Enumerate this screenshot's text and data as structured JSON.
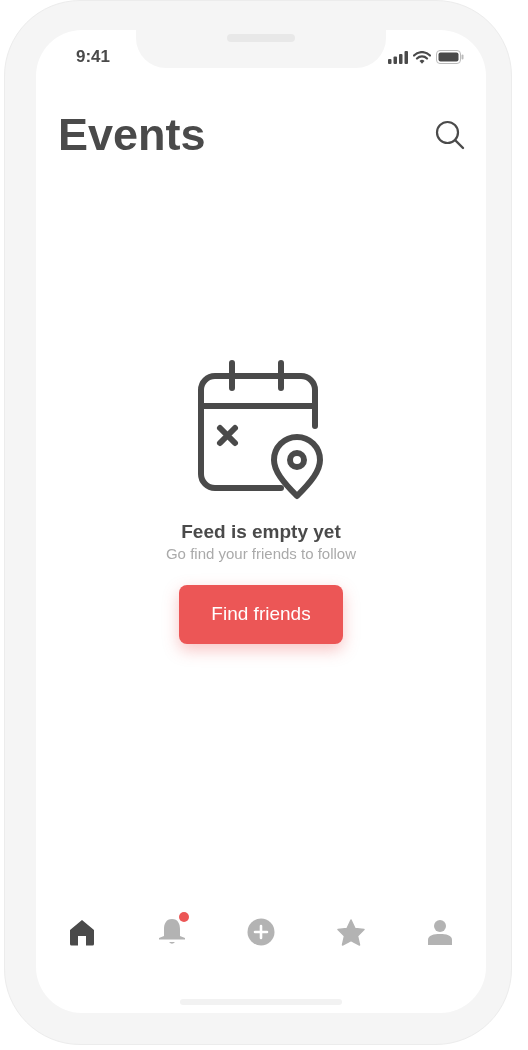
{
  "status_bar": {
    "time": "9:41"
  },
  "header": {
    "title": "Events"
  },
  "empty_state": {
    "title": "Feed is empty yet",
    "subtitle": "Go find your friends to follow",
    "button": "Find friends"
  },
  "tab_bar": [
    {
      "kind": "home",
      "selected": true,
      "badge": false
    },
    {
      "kind": "bell",
      "selected": false,
      "badge": true
    },
    {
      "kind": "plus",
      "selected": false,
      "badge": false
    },
    {
      "kind": "star",
      "selected": false,
      "badge": false
    },
    {
      "kind": "user",
      "selected": false,
      "badge": false
    }
  ]
}
